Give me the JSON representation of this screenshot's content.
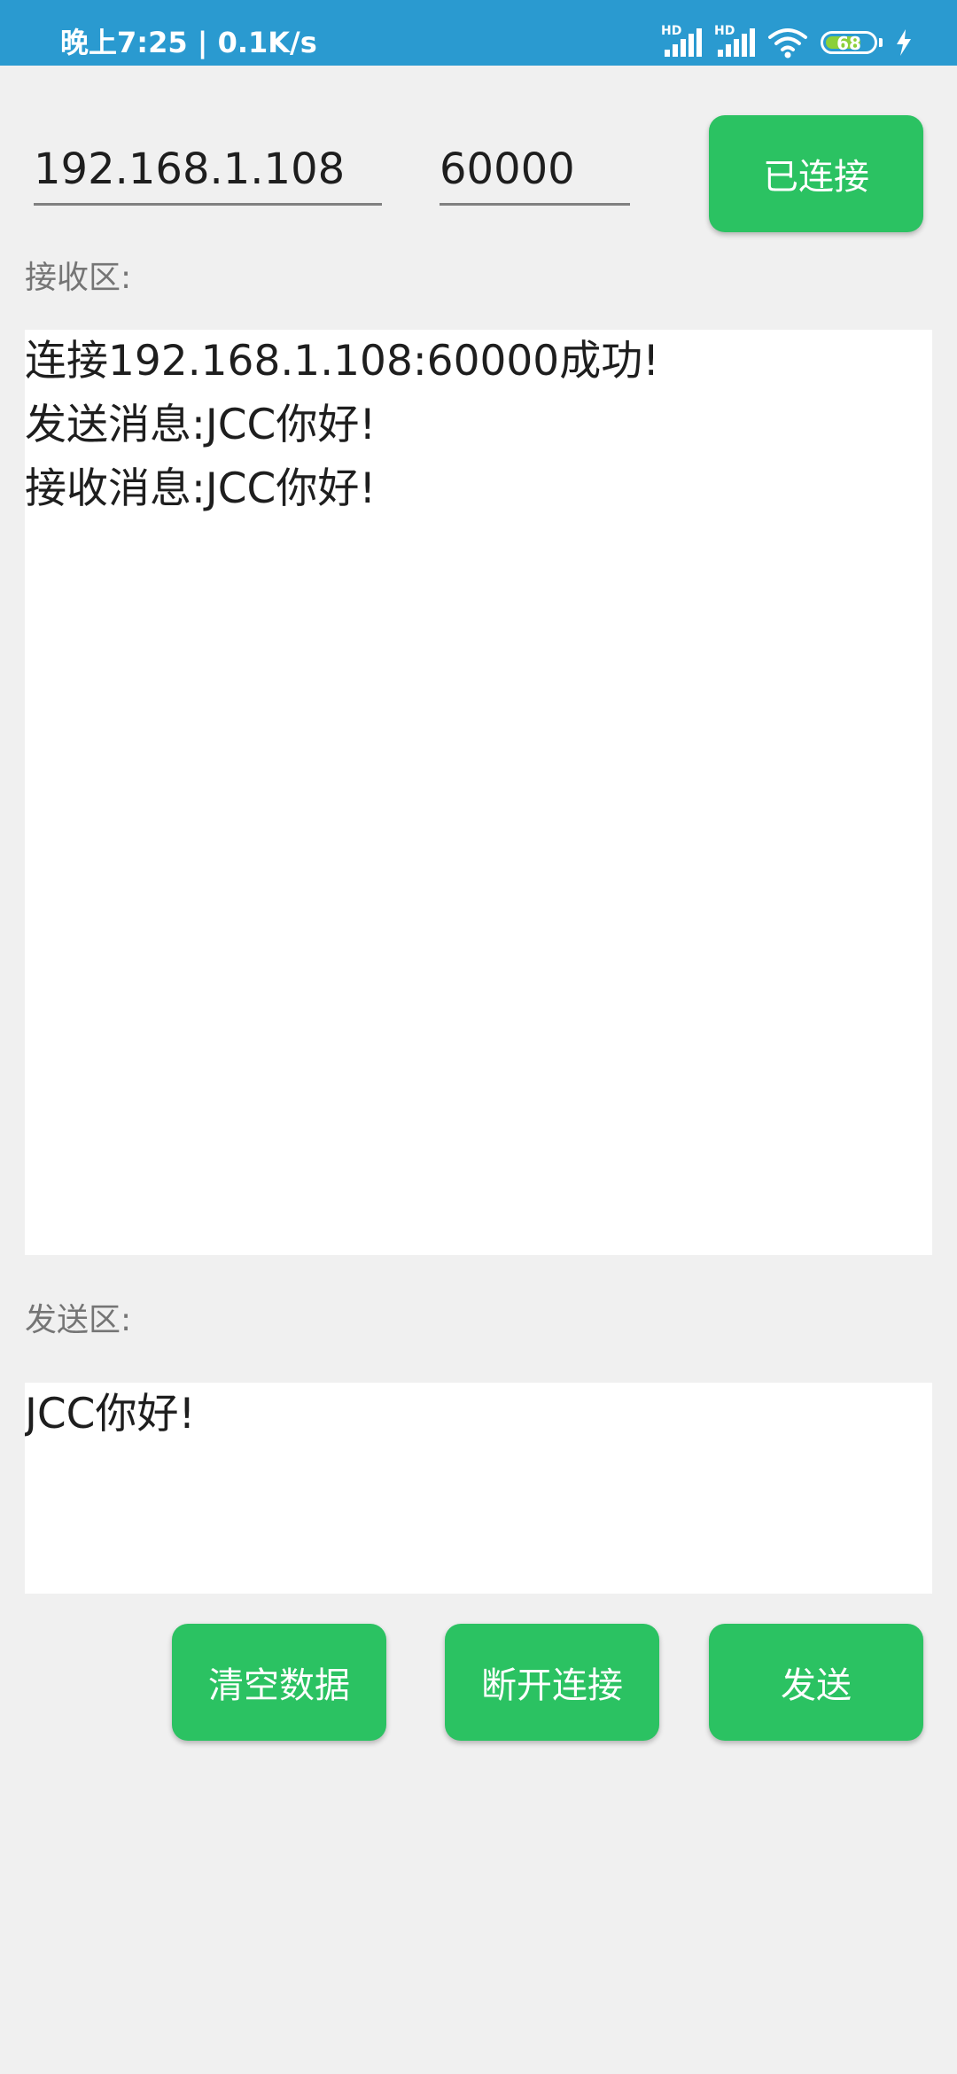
{
  "status_bar": {
    "time_speed": "晚上7:25 | 0.1K/s",
    "sim1_label": "HD",
    "sim2_label": "HD",
    "battery_level": "68",
    "icons": [
      "signal-icon",
      "signal-icon",
      "wifi-icon",
      "battery-icon",
      "charging-icon"
    ]
  },
  "connection": {
    "ip": "192.168.1.108",
    "port": "60000",
    "connect_button": "已连接"
  },
  "receive": {
    "label": "接收区:",
    "lines": [
      "连接192.168.1.108:60000成功!",
      "发送消息:JCC你好!",
      "接收消息:JCC你好!"
    ]
  },
  "send": {
    "label": "发送区:",
    "text": "JCC你好!"
  },
  "buttons": {
    "clear": "清空数据",
    "disconnect": "断开连接",
    "send": "发送"
  },
  "colors": {
    "status_bar": "#2a9ad0",
    "accent_green": "#2bc262",
    "background": "#f0f0f0"
  }
}
